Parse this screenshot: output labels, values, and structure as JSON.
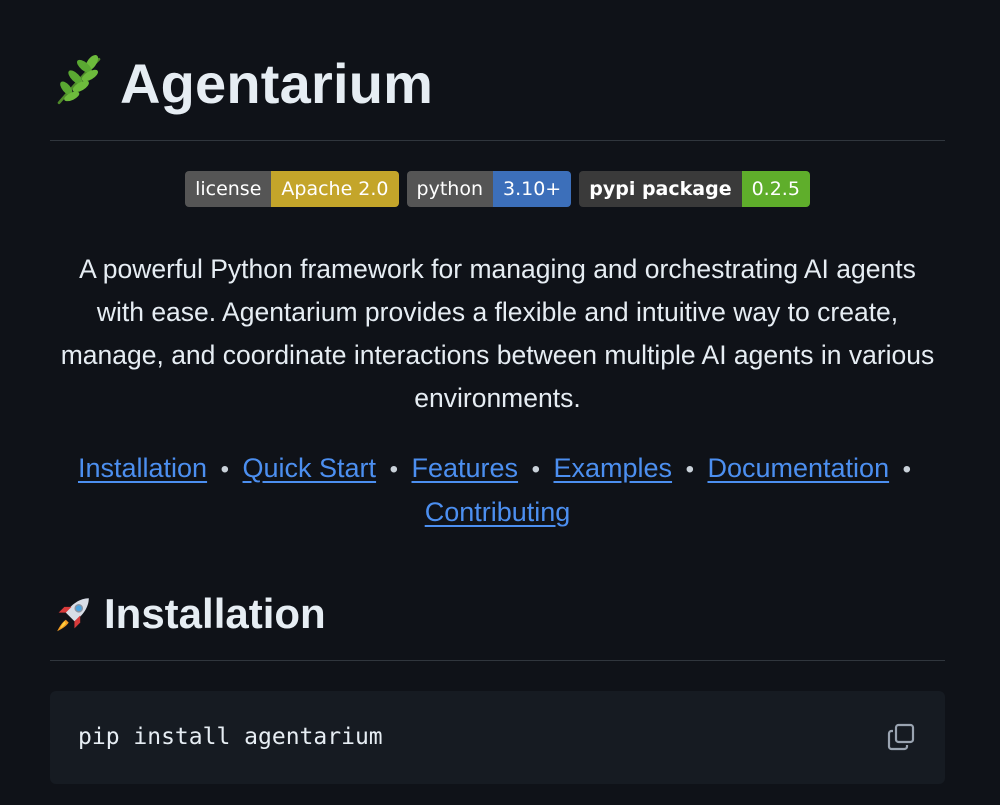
{
  "header": {
    "title": "Agentarium",
    "emoji_icon": "herb-icon"
  },
  "badges": [
    {
      "label": "license",
      "value": "Apache 2.0",
      "color": "#c4a52a"
    },
    {
      "label": "python",
      "value": "3.10+",
      "color": "#3c6fba"
    },
    {
      "label": "pypi package",
      "value": "0.2.5",
      "color": "#5fae2b"
    }
  ],
  "description": "A powerful Python framework for managing and orchestrating AI agents with ease. Agentarium provides a flexible and intuitive way to create, manage, and coordinate interactions between multiple AI agents in various environments.",
  "nav": {
    "separator": "•",
    "links": [
      "Installation",
      "Quick Start",
      "Features",
      "Examples",
      "Documentation",
      "Contributing"
    ]
  },
  "installation": {
    "title": "Installation",
    "emoji_icon": "rocket-icon",
    "command": "pip install agentarium",
    "copy_icon": "copy-icon"
  },
  "colors": {
    "background": "#0f1218",
    "link": "#4c8ff0",
    "code_background": "#161b22"
  }
}
